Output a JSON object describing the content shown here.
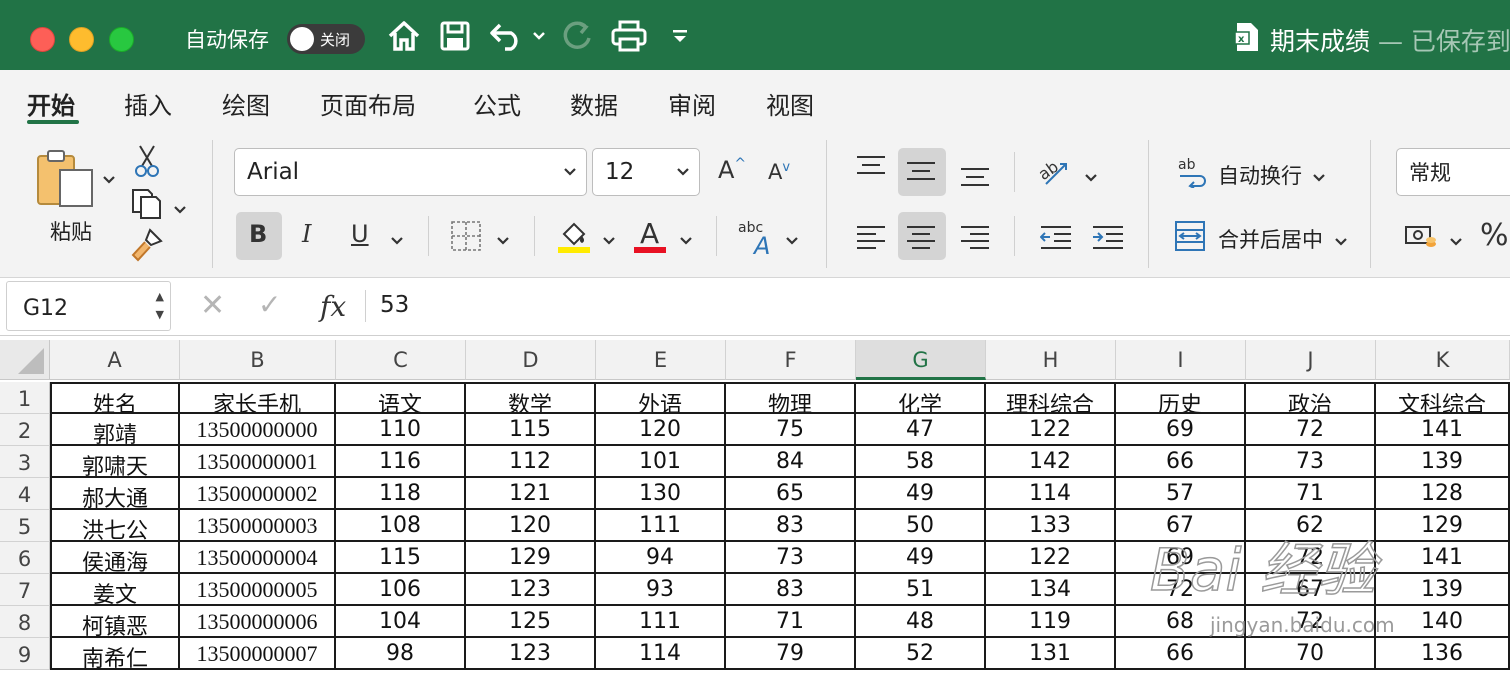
{
  "titlebar": {
    "autosave_label": "自动保存",
    "autosave_toggle": "关闭",
    "doc_title": "期末成绩",
    "doc_status": " — 已保存到"
  },
  "tabs": [
    {
      "label": "开始",
      "active": true
    },
    {
      "label": "插入"
    },
    {
      "label": "绘图"
    },
    {
      "label": "页面布局"
    },
    {
      "label": "公式"
    },
    {
      "label": "数据"
    },
    {
      "label": "审阅"
    },
    {
      "label": "视图"
    }
  ],
  "ribbon": {
    "paste_label": "粘贴",
    "font_name": "Arial",
    "font_size": "12",
    "bold": "B",
    "italic": "I",
    "underline": "U",
    "wrap_text_label": "自动换行",
    "merge_center_label": "合并后居中",
    "number_format": "常规",
    "percent": "%"
  },
  "formula_bar": {
    "name_box": "G12",
    "fx": "fx",
    "value": "53"
  },
  "sheet": {
    "columns": [
      "A",
      "B",
      "C",
      "D",
      "E",
      "F",
      "G",
      "H",
      "I",
      "J",
      "K"
    ],
    "active_column": "G",
    "rows": [
      "1",
      "2",
      "3",
      "4",
      "5",
      "6",
      "7",
      "8",
      "9"
    ],
    "header": [
      "姓名",
      "家长手机",
      "语文",
      "数学",
      "外语",
      "物理",
      "化学",
      "理科综合",
      "历史",
      "政治",
      "文科综合"
    ],
    "data": [
      [
        "郭靖",
        "13500000000",
        "110",
        "115",
        "120",
        "75",
        "47",
        "122",
        "69",
        "72",
        "141"
      ],
      [
        "郭啸天",
        "13500000001",
        "116",
        "112",
        "101",
        "84",
        "58",
        "142",
        "66",
        "73",
        "139"
      ],
      [
        "郝大通",
        "13500000002",
        "118",
        "121",
        "130",
        "65",
        "49",
        "114",
        "57",
        "71",
        "128"
      ],
      [
        "洪七公",
        "13500000003",
        "108",
        "120",
        "111",
        "83",
        "50",
        "133",
        "67",
        "62",
        "129"
      ],
      [
        "侯通海",
        "13500000004",
        "115",
        "129",
        "94",
        "73",
        "49",
        "122",
        "69",
        "72",
        "141"
      ],
      [
        "姜文",
        "13500000005",
        "106",
        "123",
        "93",
        "83",
        "51",
        "134",
        "72",
        "67",
        "139"
      ],
      [
        "柯镇恶",
        "13500000006",
        "104",
        "125",
        "111",
        "71",
        "48",
        "119",
        "68",
        "72",
        "140"
      ],
      [
        "南希仁",
        "13500000007",
        "98",
        "123",
        "114",
        "79",
        "52",
        "131",
        "66",
        "70",
        "136"
      ]
    ]
  },
  "watermark": {
    "text": "Bai 经验",
    "subtext": "jingyan.baidu.com"
  },
  "colors": {
    "accent": "#217346",
    "highlight_yellow": "#ffeb00",
    "font_red": "#e81123"
  }
}
